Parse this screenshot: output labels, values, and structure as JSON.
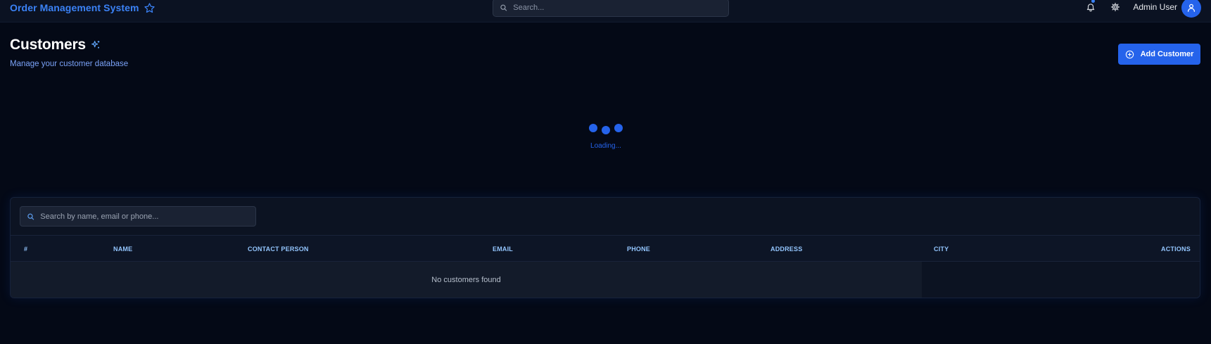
{
  "header": {
    "app_title": "Order Management System",
    "star_icon": "star-icon",
    "search": {
      "placeholder": "Search...",
      "value": ""
    },
    "notifications_icon": "bell-icon",
    "settings_icon": "gear-icon",
    "user_name": "Admin User",
    "avatar_icon": "user-icon"
  },
  "page": {
    "title": "Customers",
    "title_icon": "sparkle-icon",
    "subtitle": "Manage your customer database",
    "add_button_label": "Add Customer",
    "add_button_icon": "plus-circle-icon"
  },
  "loading": {
    "text": "Loading..."
  },
  "table": {
    "search": {
      "placeholder": "Search by name, email or phone...",
      "value": ""
    },
    "columns": [
      "#",
      "NAME",
      "CONTACT PERSON",
      "EMAIL",
      "PHONE",
      "ADDRESS",
      "CITY",
      "ACTIONS"
    ],
    "empty_text": "No customers found"
  },
  "colors": {
    "accent": "#2563eb",
    "brand_text": "#3b82f6",
    "background": "#040916",
    "card": "#0c1322"
  }
}
